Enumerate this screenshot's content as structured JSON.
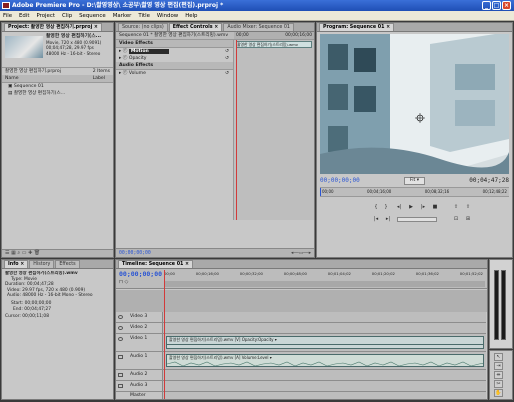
{
  "window": {
    "title": "Adobe Premiere Pro - D:\\촬영영상\\ 소공부\\촬영 영상 편집(편집).prproj *"
  },
  "menu": [
    "File",
    "Edit",
    "Project",
    "Clip",
    "Sequence",
    "Marker",
    "Title",
    "Window",
    "Help"
  ],
  "project": {
    "tab": "Project: 촬영한 영상 편집하기.prproj ×",
    "clip_name": "촬영한 영상 편집하기(스...",
    "clip_info": [
      "Movie, 720 x 480 (0.9091)",
      "00;04;47;28, 29.97 fps",
      "48000 Hz - 16-bit - Stereo"
    ],
    "project_file": "촬영한 영상 편집하기.prproj",
    "item_count": "2 Items",
    "col_name": "Name",
    "col_label": "Label",
    "items": [
      "Sequence 01",
      "촬영한 영상 편집하기(스..."
    ]
  },
  "effect_controls": {
    "tabs": [
      "Source: (no clips)",
      "Effect Controls ×",
      "Audio Mixer: Sequence 01"
    ],
    "sequence_path": "Sequence 01 * 촬영한 영상 편집하기(스트리밍).wmv",
    "time_start": "00;00",
    "time_end": "00;00;16;00",
    "clip_label": "촬영한 영상 편집하기(스트리밍).wmv",
    "video_effects": "Video Effects",
    "motion": "Motion",
    "opacity": "Opacity",
    "audio_effects": "Audio Effects",
    "volume": "Volume",
    "timecode": "00;00;00;00"
  },
  "program": {
    "tab": "Program: Sequence 01 ×",
    "current_time": "00;00;00;00",
    "fit": "Fit",
    "duration": "00;04;47;28",
    "ruler": [
      "00;00",
      "00;04;16;00",
      "00;08;32;16",
      "00;12;48;22"
    ]
  },
  "info": {
    "tabs": [
      "Info ×",
      "History",
      "Effects"
    ],
    "clip": "촬영한 영상 편집하기(스트리밍).wmv",
    "lines": [
      "Type: Movie",
      "Duration: 00;04;47;28",
      "Video: 29.97 fps, 720 x 480 (0.909)",
      "Audio: 48000 Hz - 16-bit Mono - Stereo",
      "Start: 00;00;00;00",
      "End: 00;04;47;27",
      "Cursor: 00;00;11;08"
    ]
  },
  "timeline": {
    "tab": "Timeline: Sequence 01 ×",
    "timecode": "00;00;00;00",
    "ruler": [
      "00;00",
      "00;00;16;00",
      "00;00;32;00",
      "00;00;48;00",
      "00;01;04;02",
      "00;01;20;02",
      "00;01;36;02",
      "00;01;52;02"
    ],
    "tracks": [
      "Video 3",
      "Video 2",
      "Video 1",
      "Audio 1",
      "Audio 2",
      "Audio 3",
      "Master"
    ],
    "video_clip": "촬영한 영상 편집하기(스트리밍).wmv [V] Opacity:Opacity ▾",
    "audio_clip": "촬영한 영상 편집하기(스트리밍).wmv [A] Volume:Level ▾"
  }
}
